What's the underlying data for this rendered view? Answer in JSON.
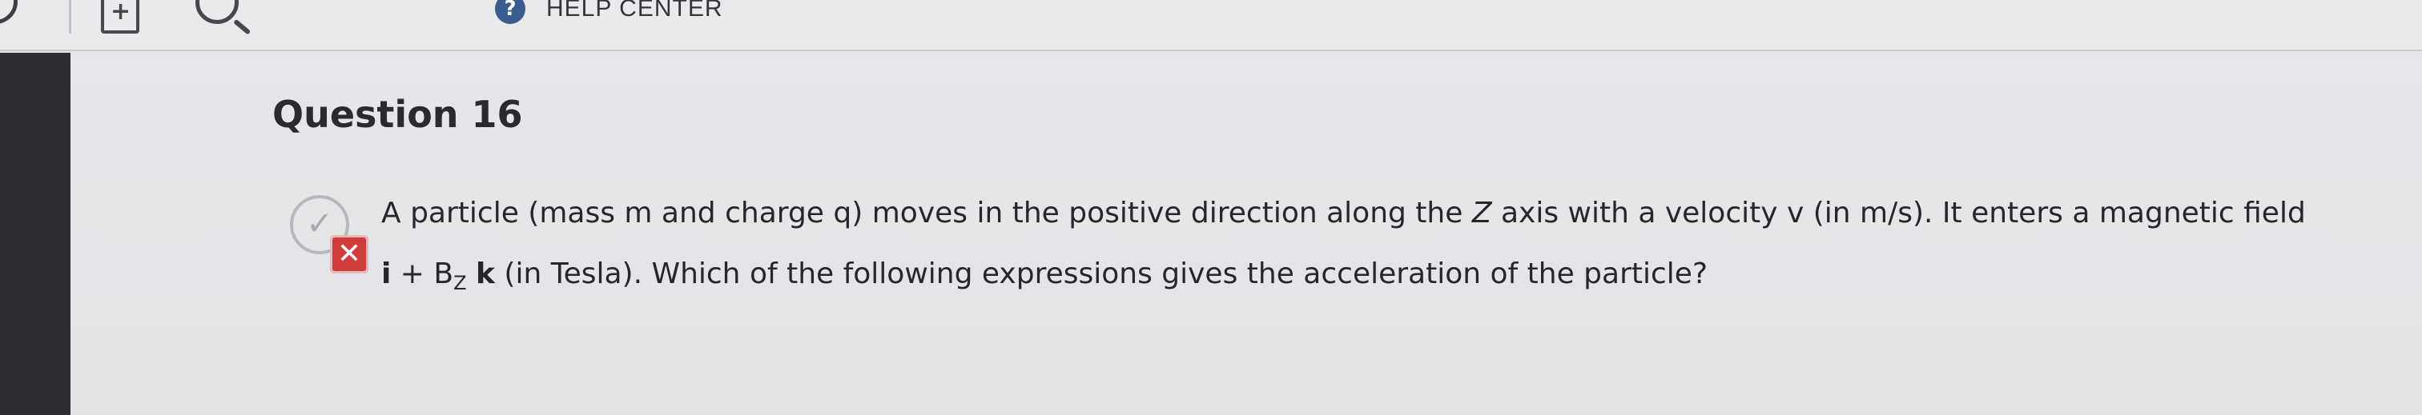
{
  "topbar": {
    "help_label": "HELP CENTER",
    "help_icon_glyph": "?",
    "add_icon_glyph": "+"
  },
  "question": {
    "title": "Question 16",
    "status": "incorrect",
    "status_glyph": "✕",
    "line1": {
      "part1": "A particle (mass  m and charge q) moves in the positive direction along the ",
      "axis": "Z",
      "part2": " axis with a velocity v (in m/s). It enters a magnetic field"
    },
    "line2": {
      "unit_i": "i",
      "plus": " + B",
      "sub_z": "Z",
      "unit_k": "k",
      "rest": "  (in Tesla). Which of the following expressions gives the acceleration of the particle?"
    }
  },
  "colors": {
    "left_rail": "#2c2e33",
    "help_icon": "#3a5d8f",
    "incorrect_badge": "#d13b3b"
  }
}
